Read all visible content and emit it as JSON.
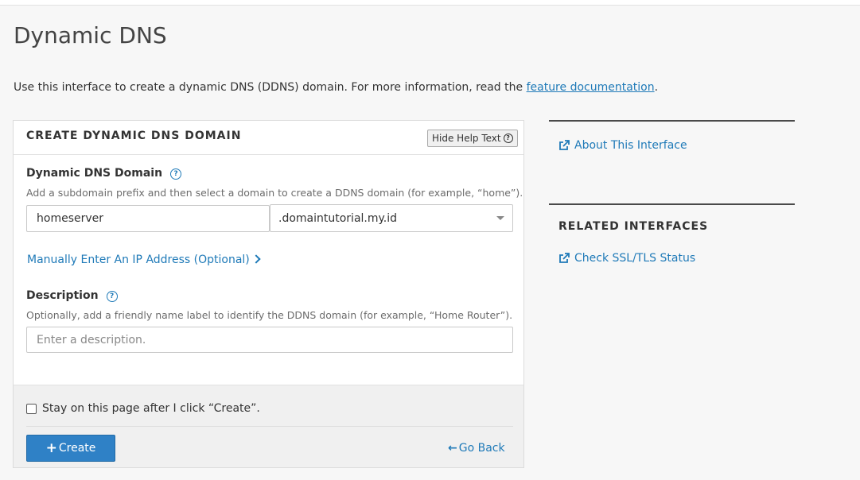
{
  "page": {
    "title": "Dynamic DNS",
    "intro_text": "Use this interface to create a dynamic DNS (DDNS) domain. For more information, read the ",
    "intro_link": "feature documentation",
    "intro_suffix": "."
  },
  "panel": {
    "title": "CREATE DYNAMIC DNS DOMAIN",
    "help_button": "Hide Help Text",
    "ddns_field": {
      "label": "Dynamic DNS Domain",
      "help": "Add a subdomain prefix and then select a domain to create a DDNS domain (for example, “home”).",
      "value": "homeserver",
      "domain_selected": ".domaintutorial.my.id"
    },
    "manual_ip_link": "Manually Enter An IP Address (Optional)",
    "description_field": {
      "label": "Description",
      "help": "Optionally, add a friendly name label to identify the DDNS domain (for example, “Home Router”).",
      "placeholder": "Enter a description.",
      "value": ""
    },
    "stay_checkbox": {
      "label": "Stay on this page after I click “Create”.",
      "checked": false
    },
    "create_button": "Create",
    "go_back_link": "Go Back"
  },
  "sidebar": {
    "about_link": "About This Interface",
    "related_heading": "RELATED INTERFACES",
    "related_links": [
      {
        "label": "Check SSL/TLS Status"
      }
    ]
  },
  "colors": {
    "link": "#1f7ab8",
    "primary_button": "#2f81c6",
    "footer_bg": "#f0f0f0",
    "page_bg": "#f7f7f7"
  }
}
